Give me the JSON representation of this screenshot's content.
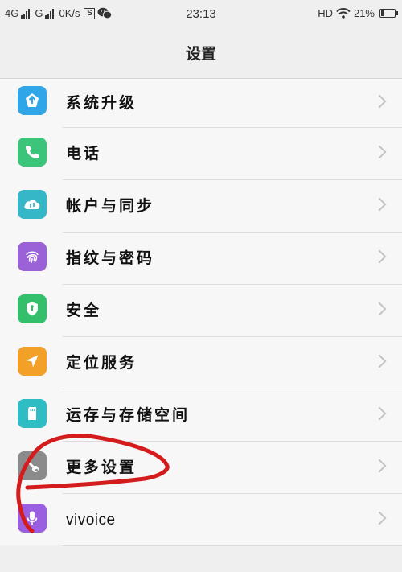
{
  "status_bar": {
    "network1": "4G",
    "network2": "G",
    "speed": "0K/s",
    "sim_badge": "S",
    "time": "23:13",
    "hd": "HD",
    "battery_percent": "21%"
  },
  "header": {
    "title": "设置"
  },
  "menu": {
    "items": [
      {
        "label": "系统升级",
        "icon": "system-update-icon",
        "color": "#2fa6e8"
      },
      {
        "label": "电话",
        "icon": "phone-icon",
        "color": "#3bc47a"
      },
      {
        "label": "帐户与同步",
        "icon": "cloud-sync-icon",
        "color": "#36b7c8"
      },
      {
        "label": "指纹与密码",
        "icon": "fingerprint-icon",
        "color": "#9a62d6"
      },
      {
        "label": "安全",
        "icon": "shield-icon",
        "color": "#33bf6c"
      },
      {
        "label": "定位服务",
        "icon": "location-arrow-icon",
        "color": "#f2a028"
      },
      {
        "label": "运存与存储空间",
        "icon": "storage-card-icon",
        "color": "#2fbcc3"
      },
      {
        "label": "更多设置",
        "icon": "wrench-icon",
        "color": "#8b8b8b"
      },
      {
        "label": "vivoice",
        "icon": "microphone-icon",
        "color": "#9a5ee0"
      }
    ]
  },
  "annotation": {
    "color": "#d41c1c"
  }
}
